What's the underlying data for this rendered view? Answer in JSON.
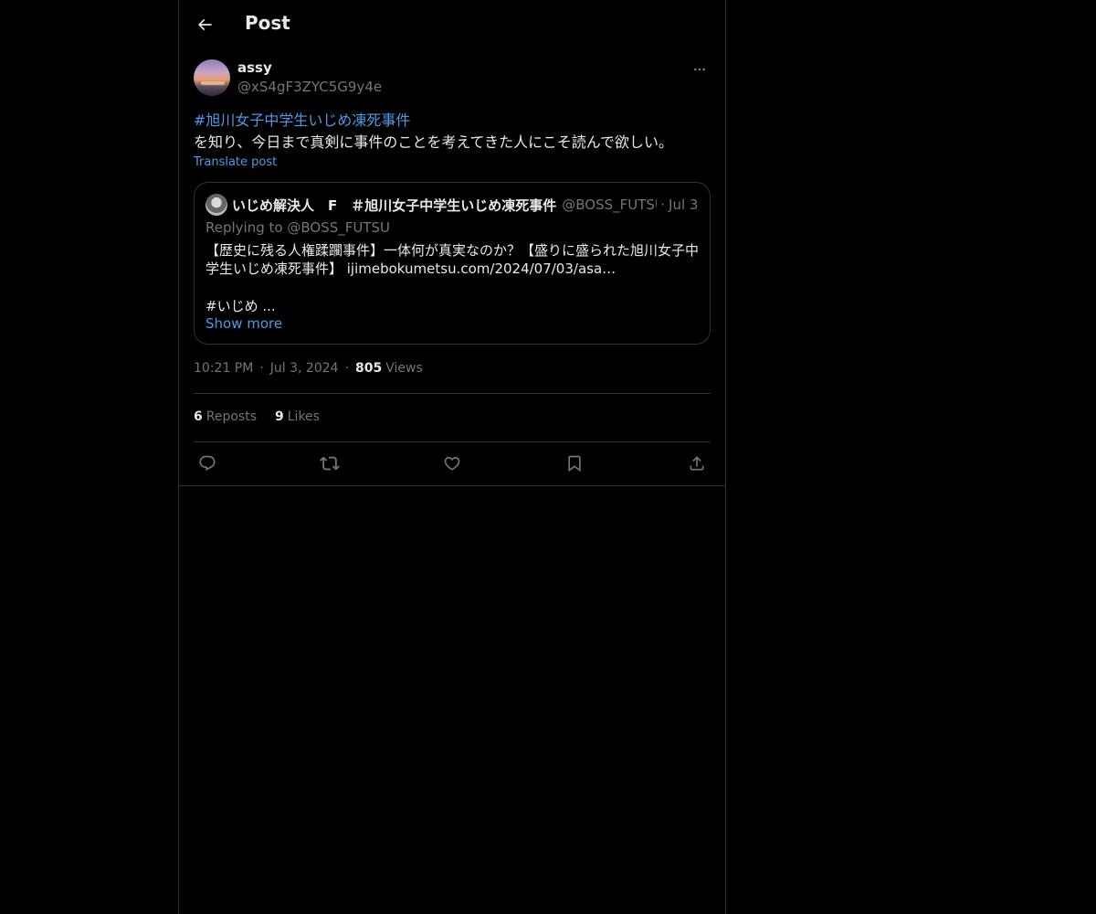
{
  "header": {
    "title": "Post"
  },
  "author": {
    "display_name": "assy",
    "handle": "@xS4gF3ZYC5G9y4e"
  },
  "post": {
    "hashtag": "#旭川女子中学生いじめ凍死事件",
    "body": "を知り、今日まで真剣に事件のことを考えてきた人にこそ読んで欲しい。",
    "translate_label": "Translate post"
  },
  "quote": {
    "name": "いじめ解決人　F　＃旭川女子中学生いじめ凍死事件",
    "handle": "@BOSS_FUTSU",
    "dot": "·",
    "date": "Jul 3",
    "replying": "Replying to @BOSS_FUTSU",
    "body_line1": "【歴史に残る人権蹂躙事件】一体何が真実なのか？【盛りに盛られた旭川女子中",
    "body_line2": "学生いじめ凍死事件】 ijimebokumetsu.com/2024/07/03/asa…",
    "hashtag": "#いじめ ...",
    "show_more": "Show more"
  },
  "meta": {
    "time": "10:21 PM",
    "date": "Jul 3, 2024",
    "separator": "·",
    "views_count": "805",
    "views_label": "Views"
  },
  "stats": {
    "reposts_count": "6",
    "reposts_label": "Reposts",
    "likes_count": "9",
    "likes_label": "Likes"
  },
  "colors": {
    "background": "#000000",
    "text": "#e7e9ea",
    "secondary": "#71767b",
    "link": "#4c9ae6",
    "border": "#2f3336"
  },
  "icons": {
    "back": "arrow-left-icon",
    "more": "more-icon",
    "reply": "reply-icon",
    "repost": "repost-icon",
    "like": "heart-icon",
    "bookmark": "bookmark-icon",
    "share": "share-icon"
  }
}
